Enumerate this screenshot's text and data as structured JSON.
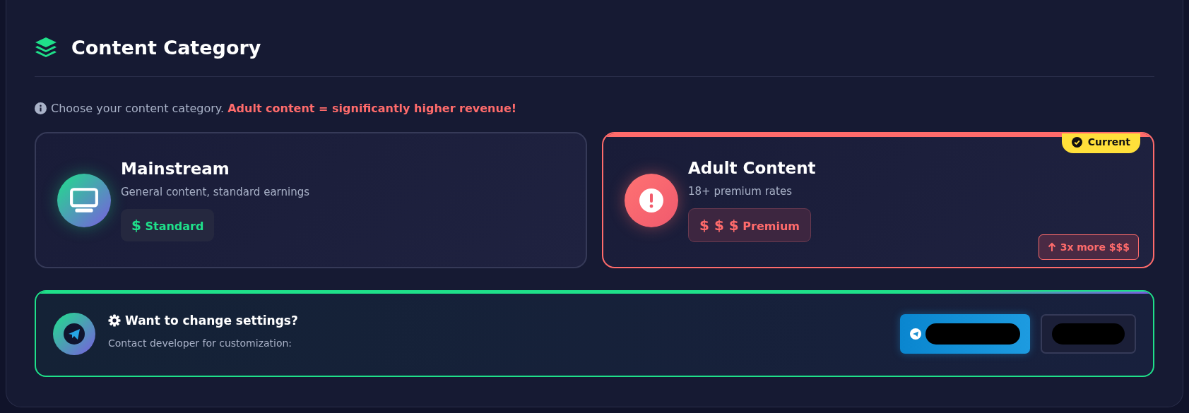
{
  "header": {
    "title": "Content Category"
  },
  "info": {
    "text": "Choose your content category. **Adult content = significantly higher revenue!**"
  },
  "categories": [
    {
      "kind": "mainstream",
      "title": "Mainstream",
      "description": "General content, standard earnings",
      "tag_symbols": "$",
      "tag_label": "Standard",
      "selected": false
    },
    {
      "kind": "adult",
      "title": "Adult Content",
      "description": "18+ premium rates",
      "tag_symbols": "$ $ $",
      "tag_label": "Premium",
      "selected": true,
      "badge": "Current",
      "boost": "3x more $$$"
    }
  ],
  "contact": {
    "title": "Want to change settings?",
    "subtitle": "Contact developer for customization:",
    "buttons": [
      {
        "kind": "telegram",
        "redacted": true
      },
      {
        "kind": "plain",
        "redacted": true
      }
    ]
  }
}
